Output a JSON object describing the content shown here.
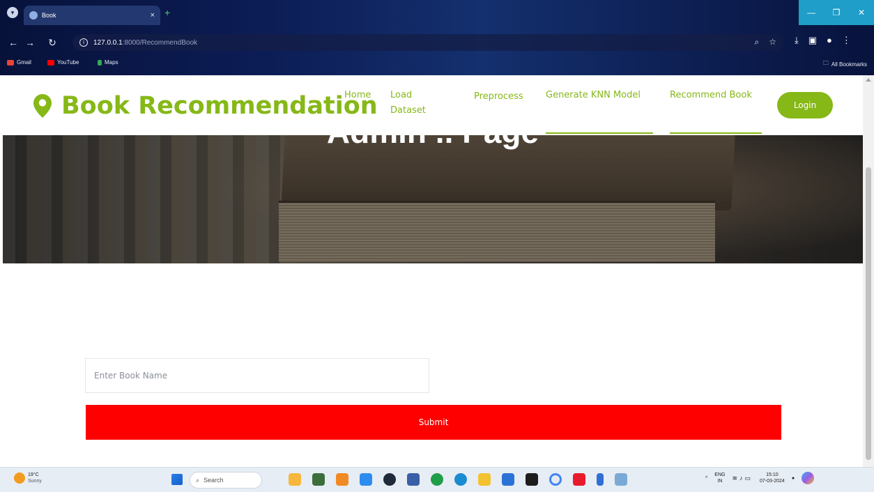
{
  "browser": {
    "tab_title": "Book",
    "tab_close": "×",
    "new_tab": "+",
    "url_host": "127.0.0.1",
    "url_path": ":8000/RecommendBook",
    "bookmarks": [
      "Gmail",
      "YouTube",
      "Maps"
    ],
    "all_bookmarks": "All Bookmarks"
  },
  "navbar": {
    "brand": "Book Recommendation",
    "links": [
      {
        "label": "Home"
      },
      {
        "label": "Load Dataset"
      },
      {
        "label": "Preprocess"
      },
      {
        "label": "Generate KNN Model"
      },
      {
        "label": "Recommend Book"
      }
    ],
    "login_label": "Login"
  },
  "hero": {
    "title": "Admin .. Page"
  },
  "form": {
    "book_placeholder": "Enter Book Name",
    "book_value": "",
    "submit_label": "Submit"
  },
  "taskbar": {
    "weather_temp": "19°C",
    "weather_cond": "Sunny",
    "search_label": "Search",
    "lang_line1": "ENG",
    "lang_line2": "IN",
    "time": "15:10",
    "date": "07-03-2024"
  },
  "colors": {
    "brand": "#86b817",
    "submit": "#ff0000",
    "chrome": "#0c1c55"
  },
  "icons": {
    "pin": "map-pin-icon",
    "window": [
      "minimize-icon",
      "maximize-icon",
      "close-icon"
    ]
  }
}
